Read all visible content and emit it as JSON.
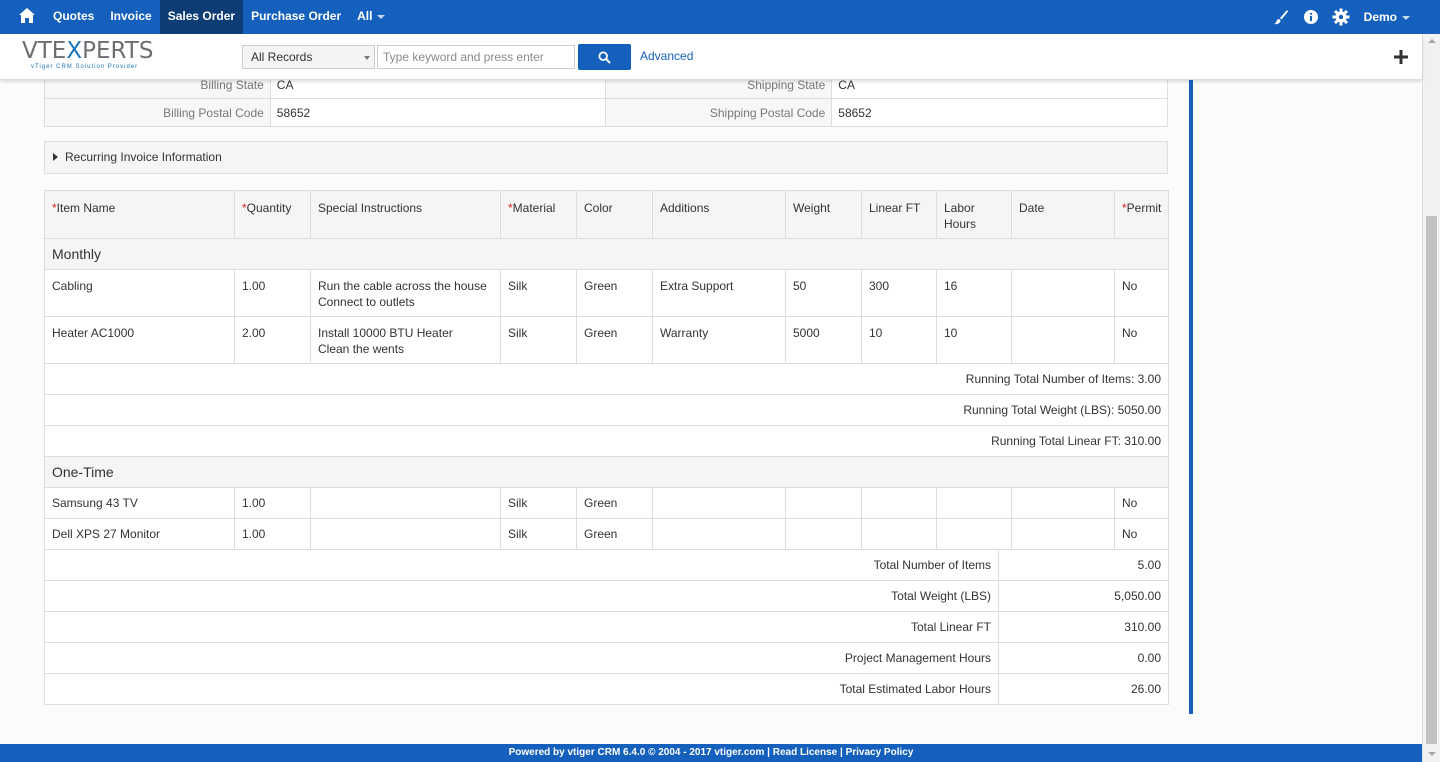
{
  "nav": {
    "items": [
      {
        "label": "Quotes",
        "active": false
      },
      {
        "label": "Invoice",
        "active": false
      },
      {
        "label": "Sales Order",
        "active": true
      },
      {
        "label": "Purchase Order",
        "active": false
      },
      {
        "label": "All",
        "active": false
      }
    ],
    "user": "Demo"
  },
  "header": {
    "logo_main_left": "VTE",
    "logo_main_x": "X",
    "logo_main_right": "PERTS",
    "logo_tag": "vTiger CRM Solution Provider",
    "filter_value": "All Records",
    "search_placeholder": "Type keyword and press enter",
    "advanced_label": "Advanced"
  },
  "address": {
    "rows": [
      {
        "l1": "Billing State",
        "v1": "CA",
        "l2": "Shipping State",
        "v2": "CA"
      },
      {
        "l1": "Billing Postal Code",
        "v1": "58652",
        "l2": "Shipping Postal Code",
        "v2": "58652"
      }
    ]
  },
  "recurring": {
    "label": "Recurring Invoice Information"
  },
  "items": {
    "headers": [
      {
        "label": "Item Name",
        "required": true
      },
      {
        "label": "Quantity",
        "required": true
      },
      {
        "label": "Special Instructions",
        "required": false
      },
      {
        "label": "Material",
        "required": true
      },
      {
        "label": "Color",
        "required": false
      },
      {
        "label": "Additions",
        "required": false
      },
      {
        "label": "Weight",
        "required": false
      },
      {
        "label": "Linear FT",
        "required": false
      },
      {
        "label": "Labor Hours",
        "required": false
      },
      {
        "label": "Date",
        "required": false
      },
      {
        "label": "Permit",
        "required": true
      }
    ],
    "groups": [
      {
        "name": "Monthly",
        "rows": [
          {
            "cells": [
              "Cabling",
              "1.00",
              "Run the cable across the house\nConnect to outlets",
              "Silk",
              "Green",
              "Extra Support",
              "50",
              "300",
              "16",
              "",
              "No"
            ]
          },
          {
            "cells": [
              "Heater AC1000",
              "2.00",
              "Install 10000 BTU Heater\nClean the wents",
              "Silk",
              "Green",
              "Warranty",
              "5000",
              "10",
              "10",
              "",
              "No"
            ]
          }
        ],
        "running": [
          "Running Total Number of Items: 3.00",
          "Running Total Weight (LBS): 5050.00",
          "Running Total Linear FT: 310.00"
        ]
      },
      {
        "name": "One-Time",
        "rows": [
          {
            "cells": [
              "Samsung 43 TV",
              "1.00",
              "",
              "Silk",
              "Green",
              "",
              "",
              "",
              "",
              "",
              "No"
            ]
          },
          {
            "cells": [
              "Dell XPS 27 Monitor",
              "1.00",
              "",
              "Silk",
              "Green",
              "",
              "",
              "",
              "",
              "",
              "No"
            ]
          }
        ],
        "running": []
      }
    ]
  },
  "totals": [
    {
      "label": "Total Number of Items",
      "value": "5.00"
    },
    {
      "label": "Total Weight (LBS)",
      "value": "5,050.00"
    },
    {
      "label": "Total Linear FT",
      "value": "310.00"
    },
    {
      "label": "Project Management Hours",
      "value": "0.00"
    },
    {
      "label": "Total Estimated Labor Hours",
      "value": "26.00"
    }
  ],
  "footer": {
    "text": "Powered by vtiger CRM 6.4.0  © 2004 - 2017  vtiger.com | Read License | Privacy Policy"
  },
  "colors": {
    "primary": "#1560bd",
    "nav_active": "#0e3d75",
    "required": "#d9231e"
  }
}
